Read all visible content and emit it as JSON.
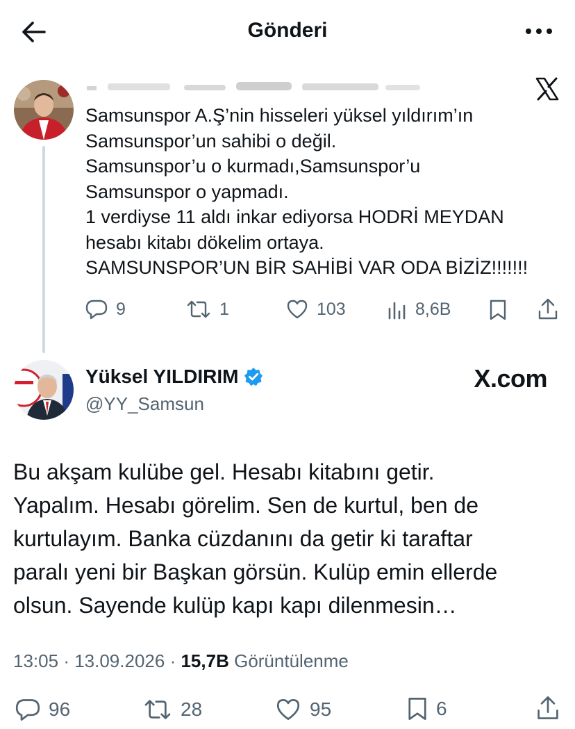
{
  "header": {
    "title": "Gönderi",
    "back_icon": "arrow-left-icon",
    "more_icon": "more-horizontal-icon"
  },
  "quoted_tweet": {
    "handle_obscured": "",
    "text_lines": [
      "Samsunspor A.Ş’nin hisseleri yüksel yıldırım’ın",
      "Samsunspor’un sahibi o değil.",
      "Samsunspor’u o kurmadı,Samsunspor’u",
      "Samsunspor o yapmadı.",
      "1 verdiyse 11 aldı inkar ediyorsa HODRİ MEYDAN",
      "hesabı kitabı dökelim ortaya.",
      "SAMSUNSPOR’UN BİR SAHİBİ VAR ODA BİZİZ!!!!!!!"
    ],
    "replies": "9",
    "reposts": "1",
    "likes": "103",
    "views": "8,6B"
  },
  "main_tweet": {
    "name": "Yüksel YILDIRIM",
    "handle": "@YY_Samsun",
    "watermark": "X.com",
    "text_lines": [
      "Bu akşam kulübe gel. Hesabı kitabını getir.",
      "Yapalım. Hesabı görelim. Sen de kurtul, ben de",
      "kurtulayım. Banka cüzdanını da getir ki taraftar",
      "paralı yeni bir Başkan görsün. Kulüp emin ellerde",
      "olsun. Sayende kulüp kapı kapı dilenmesin…"
    ],
    "time": "13:05",
    "date": "13.09.2026",
    "views_count": "15,7B",
    "views_label": "Görüntülenme",
    "replies": "96",
    "reposts": "28",
    "likes": "95",
    "bookmarks": "6"
  },
  "colors": {
    "text": "#0f1419",
    "secondary": "#536471",
    "verified": "#1d9bf0",
    "thread_line": "#cfd9de"
  }
}
